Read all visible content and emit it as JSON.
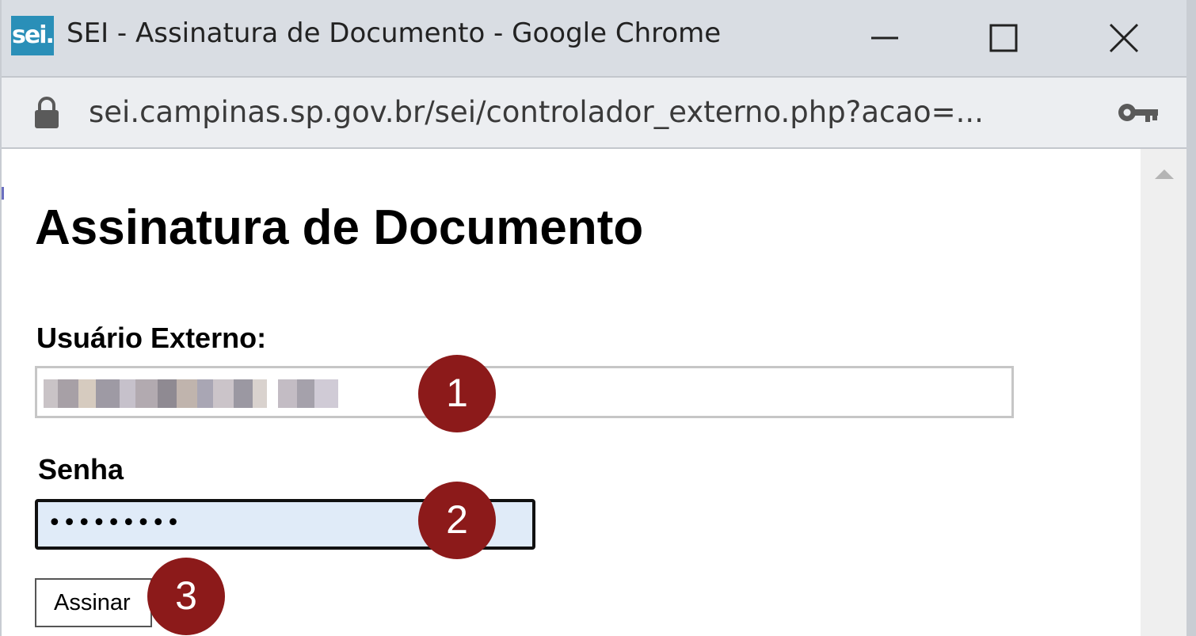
{
  "window": {
    "app_icon_text": "sei.",
    "title": "SEI - Assinatura de Documento - Google Chrome",
    "controls": {
      "minimize_icon": "minimize-icon",
      "maximize_icon": "maximize-icon",
      "close_icon": "close-icon"
    }
  },
  "addressbar": {
    "lock_icon": "lock-icon",
    "url": "sei.campinas.sp.gov.br/sei/controlador_externo.php?acao=...",
    "key_icon": "key-icon"
  },
  "page": {
    "title": "Assinatura de Documento",
    "user_label": "Usuário Externo:",
    "password_label": "Senha",
    "password_value": "•••••••••",
    "sign_button": "Assinar"
  },
  "markers": [
    "1",
    "2",
    "3"
  ],
  "colors": {
    "marker": "#8c1a1a",
    "password_field_bg": "#e0ebf8",
    "titlebar_bg": "#d9dde3",
    "app_icon_bg": "#2a8fb8"
  }
}
